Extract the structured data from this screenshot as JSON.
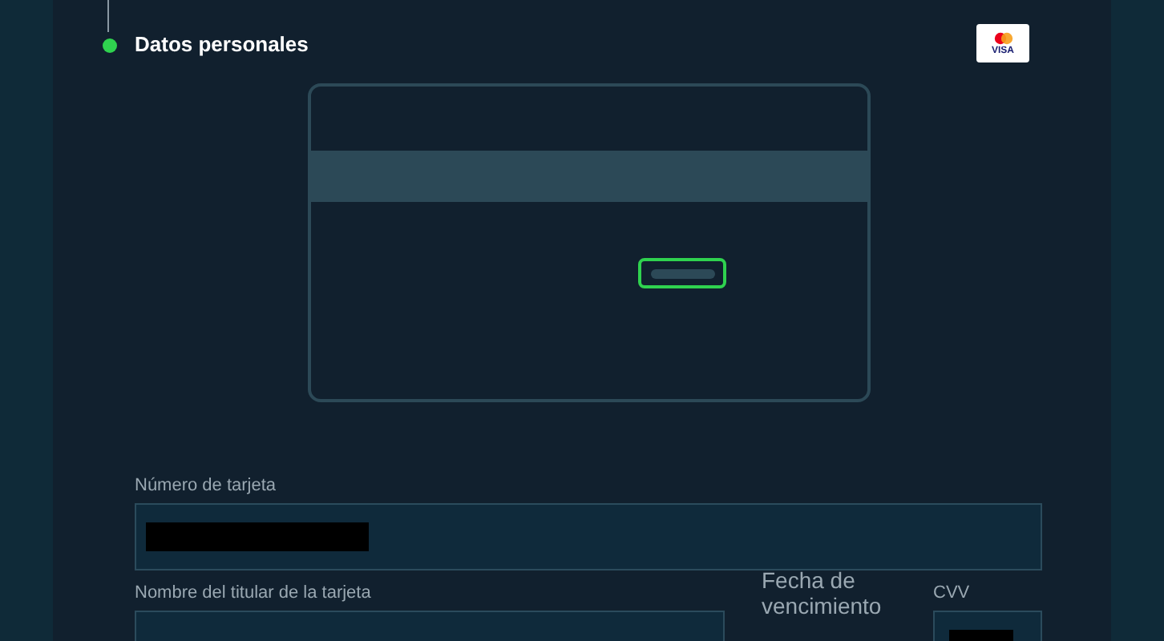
{
  "step": {
    "title": "Datos personales",
    "completed": true
  },
  "card_brand": {
    "label": "VISA"
  },
  "fields": [
    {
      "label": "Número de tarjeta",
      "redacted": true
    },
    {
      "label": "Nombre del titular de la tarjeta"
    },
    {
      "label": "Fecha de vencimiento"
    },
    {
      "label": "CVV",
      "redacted": true
    }
  ]
}
